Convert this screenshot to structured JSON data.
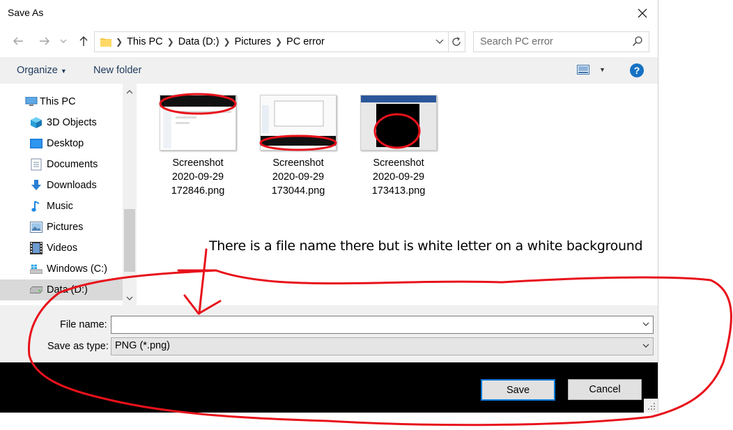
{
  "window": {
    "title": "Save As"
  },
  "address": {
    "crumbs": [
      "This PC",
      "Data (D:)",
      "Pictures",
      "PC error"
    ],
    "search_placeholder": "Search PC error"
  },
  "toolbar": {
    "organize_label": "Organize",
    "new_folder_label": "New folder"
  },
  "nav": {
    "items": [
      {
        "label": "This PC",
        "icon": "computer-icon"
      },
      {
        "label": "3D Objects",
        "icon": "cube-icon"
      },
      {
        "label": "Desktop",
        "icon": "desktop-icon"
      },
      {
        "label": "Documents",
        "icon": "documents-icon"
      },
      {
        "label": "Downloads",
        "icon": "download-icon"
      },
      {
        "label": "Music",
        "icon": "music-icon"
      },
      {
        "label": "Pictures",
        "icon": "pictures-icon"
      },
      {
        "label": "Videos",
        "icon": "video-icon"
      },
      {
        "label": "Windows (C:)",
        "icon": "windows-drive-icon"
      },
      {
        "label": "Data (D:)",
        "icon": "drive-icon",
        "selected": true
      }
    ]
  },
  "files": [
    {
      "line1": "Screenshot",
      "line2": "2020-09-29",
      "line3": "172846.png"
    },
    {
      "line1": "Screenshot",
      "line2": "2020-09-29",
      "line3": "173044.png"
    },
    {
      "line1": "Screenshot",
      "line2": "2020-09-29",
      "line3": "173413.png"
    }
  ],
  "form": {
    "file_name_label": "File name:",
    "file_name_value": "",
    "save_type_label": "Save as type:",
    "save_type_value": "PNG (*.png)"
  },
  "buttons": {
    "save_label": "Save",
    "cancel_label": "Cancel"
  },
  "annotation": {
    "text": "There is a file name there but is white letter on a white background",
    "color": "#e8121b"
  },
  "colors": {
    "accent": "#0078d7",
    "help": "#1572c4"
  }
}
